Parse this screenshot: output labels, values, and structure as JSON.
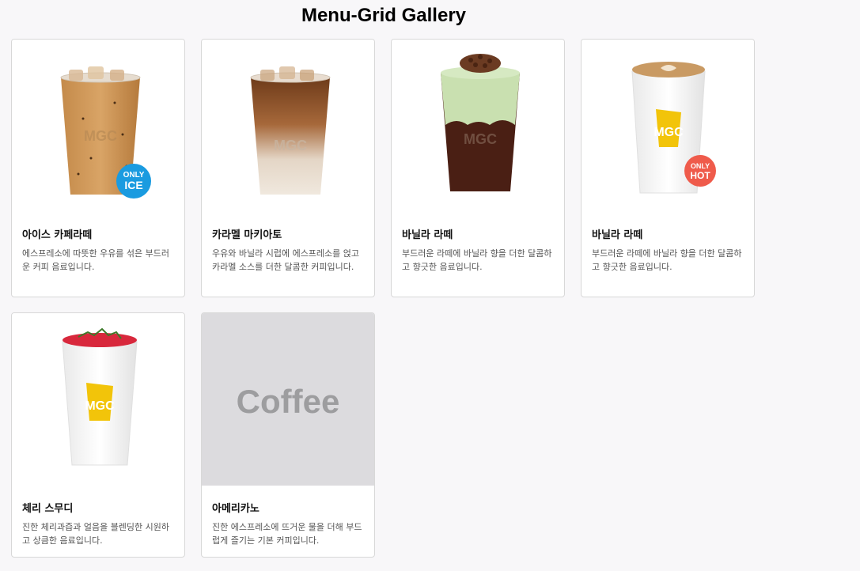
{
  "page": {
    "title": "Menu-Grid Gallery"
  },
  "items": [
    {
      "name": "아이스 카페라떼",
      "desc": "에스프레소에 따뜻한 우유를 섞은 부드러운 커피 음료입니다.",
      "badge": {
        "line1": "ONLY",
        "line2": "ICE",
        "color": "#1a9be0"
      },
      "logo": "MGC"
    },
    {
      "name": "카라멜 마키아토",
      "desc": "우유와 바닐라 시럽에 에스프레소를 얹고 카라멜 소스를 더한 달콤한 커피입니다.",
      "logo": "MGC"
    },
    {
      "name": "바닐라 라떼",
      "desc": "부드러운 라떼에 바닐라 향을 더한 달콤하고 향긋한 음료입니다.",
      "logo": "MGC"
    },
    {
      "name": "바닐라 라떼",
      "desc": "부드러운 라떼에 바닐라 향을 더한 달콤하고 향긋한 음료입니다.",
      "badge": {
        "line1": "ONLY",
        "line2": "HOT",
        "color": "#ef5b4b"
      },
      "logo": "MGC"
    },
    {
      "name": "체리 스무디",
      "desc": "진한 체리과즙과 얼음을 블렌딩한 시원하고 상큼한 음료입니다.",
      "logo": "MGC"
    },
    {
      "name": "아메리카노",
      "desc": "진한 에스프레소에 뜨거운 물을 더해 부드럽게 즐기는 기본 커피입니다.",
      "placeholder": "Coffee"
    }
  ],
  "colors": {
    "accent_yellow": "#f2c40a",
    "ice_badge": "#1a9be0",
    "hot_badge": "#ef5b4b"
  }
}
